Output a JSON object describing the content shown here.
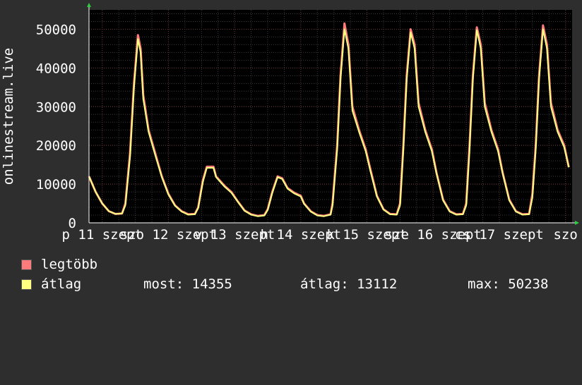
{
  "chart_data": {
    "type": "line",
    "ylabel": "onlinestream.live",
    "ylim": [
      0,
      55000
    ],
    "yticks": [
      0,
      10000,
      20000,
      30000,
      40000,
      50000
    ],
    "ytick_labels": [
      "0",
      "10000",
      "20000",
      "30000",
      "40000",
      "50000"
    ],
    "xtick_labels": [
      "p 11 szept",
      "szo 12 szept",
      "v 13 szept",
      "h 14 szept",
      "k 15 szept",
      "sze 16 szept",
      "cs 17 szept",
      "szo"
    ],
    "xticks_day": [
      0,
      1,
      2,
      3,
      4,
      5,
      6,
      7
    ],
    "xlim_day": [
      -0.2,
      7.1
    ],
    "grid": true,
    "series": [
      {
        "name": "legtöbb",
        "color": "#ff7b7b",
        "points": [
          [
            -0.2,
            12000
          ],
          [
            -0.1,
            8000
          ],
          [
            0.0,
            5000
          ],
          [
            0.1,
            3000
          ],
          [
            0.2,
            2300
          ],
          [
            0.3,
            2400
          ],
          [
            0.35,
            5000
          ],
          [
            0.42,
            18000
          ],
          [
            0.48,
            36000
          ],
          [
            0.54,
            48500
          ],
          [
            0.58,
            45000
          ],
          [
            0.62,
            33000
          ],
          [
            0.7,
            24000
          ],
          [
            0.8,
            18000
          ],
          [
            0.9,
            12000
          ],
          [
            1.0,
            7500
          ],
          [
            1.1,
            4500
          ],
          [
            1.2,
            3000
          ],
          [
            1.3,
            2200
          ],
          [
            1.4,
            2300
          ],
          [
            1.45,
            4000
          ],
          [
            1.52,
            11000
          ],
          [
            1.58,
            14500
          ],
          [
            1.68,
            14500
          ],
          [
            1.72,
            12000
          ],
          [
            1.85,
            9500
          ],
          [
            1.95,
            8000
          ],
          [
            2.05,
            5500
          ],
          [
            2.15,
            3200
          ],
          [
            2.25,
            2200
          ],
          [
            2.35,
            1800
          ],
          [
            2.45,
            2000
          ],
          [
            2.5,
            3500
          ],
          [
            2.57,
            8000
          ],
          [
            2.65,
            12000
          ],
          [
            2.72,
            11500
          ],
          [
            2.8,
            9000
          ],
          [
            2.9,
            7800
          ],
          [
            3.0,
            7000
          ],
          [
            3.05,
            5000
          ],
          [
            3.15,
            3000
          ],
          [
            3.25,
            2000
          ],
          [
            3.35,
            1800
          ],
          [
            3.45,
            2200
          ],
          [
            3.48,
            5000
          ],
          [
            3.55,
            20000
          ],
          [
            3.6,
            38000
          ],
          [
            3.66,
            51500
          ],
          [
            3.72,
            46000
          ],
          [
            3.78,
            30000
          ],
          [
            3.88,
            24000
          ],
          [
            3.98,
            19000
          ],
          [
            4.05,
            14000
          ],
          [
            4.15,
            7000
          ],
          [
            4.25,
            3500
          ],
          [
            4.35,
            2300
          ],
          [
            4.45,
            2200
          ],
          [
            4.5,
            5000
          ],
          [
            4.55,
            20000
          ],
          [
            4.6,
            38000
          ],
          [
            4.66,
            50000
          ],
          [
            4.72,
            46000
          ],
          [
            4.78,
            31000
          ],
          [
            4.88,
            24000
          ],
          [
            4.98,
            19000
          ],
          [
            5.05,
            13000
          ],
          [
            5.15,
            6000
          ],
          [
            5.25,
            3000
          ],
          [
            5.35,
            2200
          ],
          [
            5.45,
            2300
          ],
          [
            5.5,
            5000
          ],
          [
            5.55,
            20000
          ],
          [
            5.6,
            38000
          ],
          [
            5.66,
            50500
          ],
          [
            5.72,
            46000
          ],
          [
            5.78,
            31000
          ],
          [
            5.88,
            24000
          ],
          [
            5.98,
            19000
          ],
          [
            6.05,
            13000
          ],
          [
            6.15,
            6000
          ],
          [
            6.25,
            3000
          ],
          [
            6.35,
            2200
          ],
          [
            6.45,
            2300
          ],
          [
            6.5,
            7500
          ],
          [
            6.55,
            20000
          ],
          [
            6.6,
            38000
          ],
          [
            6.66,
            51000
          ],
          [
            6.72,
            46000
          ],
          [
            6.78,
            31000
          ],
          [
            6.88,
            24000
          ],
          [
            6.98,
            20000
          ],
          [
            7.05,
            14355
          ]
        ]
      },
      {
        "name": "átlag",
        "color": "#ffff80",
        "points": [
          [
            -0.2,
            12000
          ],
          [
            -0.1,
            8000
          ],
          [
            0.0,
            5000
          ],
          [
            0.1,
            3000
          ],
          [
            0.2,
            2300
          ],
          [
            0.3,
            2400
          ],
          [
            0.35,
            4500
          ],
          [
            0.42,
            17000
          ],
          [
            0.48,
            35000
          ],
          [
            0.54,
            47500
          ],
          [
            0.58,
            44000
          ],
          [
            0.62,
            32000
          ],
          [
            0.7,
            23500
          ],
          [
            0.8,
            17500
          ],
          [
            0.9,
            11800
          ],
          [
            1.0,
            7300
          ],
          [
            1.1,
            4400
          ],
          [
            1.2,
            2900
          ],
          [
            1.3,
            2100
          ],
          [
            1.4,
            2200
          ],
          [
            1.45,
            3800
          ],
          [
            1.52,
            10500
          ],
          [
            1.58,
            14200
          ],
          [
            1.68,
            14200
          ],
          [
            1.72,
            11800
          ],
          [
            1.85,
            9300
          ],
          [
            1.95,
            7800
          ],
          [
            2.05,
            5400
          ],
          [
            2.15,
            3100
          ],
          [
            2.25,
            2100
          ],
          [
            2.35,
            1700
          ],
          [
            2.45,
            1900
          ],
          [
            2.5,
            3300
          ],
          [
            2.57,
            7700
          ],
          [
            2.65,
            11800
          ],
          [
            2.72,
            11300
          ],
          [
            2.8,
            8800
          ],
          [
            2.9,
            7600
          ],
          [
            3.0,
            6800
          ],
          [
            3.05,
            4900
          ],
          [
            3.15,
            2900
          ],
          [
            3.25,
            1900
          ],
          [
            3.35,
            1700
          ],
          [
            3.45,
            2100
          ],
          [
            3.48,
            4500
          ],
          [
            3.55,
            19000
          ],
          [
            3.6,
            37000
          ],
          [
            3.66,
            50000
          ],
          [
            3.72,
            45000
          ],
          [
            3.78,
            29000
          ],
          [
            3.88,
            23500
          ],
          [
            3.98,
            18500
          ],
          [
            4.05,
            13500
          ],
          [
            4.15,
            6800
          ],
          [
            4.25,
            3400
          ],
          [
            4.35,
            2200
          ],
          [
            4.45,
            2100
          ],
          [
            4.5,
            4500
          ],
          [
            4.55,
            19000
          ],
          [
            4.6,
            37000
          ],
          [
            4.66,
            49200
          ],
          [
            4.72,
            45000
          ],
          [
            4.78,
            30000
          ],
          [
            4.88,
            23500
          ],
          [
            4.98,
            18500
          ],
          [
            5.05,
            12800
          ],
          [
            5.15,
            5800
          ],
          [
            5.25,
            2900
          ],
          [
            5.35,
            2100
          ],
          [
            5.45,
            2200
          ],
          [
            5.5,
            4500
          ],
          [
            5.55,
            19000
          ],
          [
            5.6,
            37000
          ],
          [
            5.66,
            49800
          ],
          [
            5.72,
            45000
          ],
          [
            5.78,
            30000
          ],
          [
            5.88,
            23500
          ],
          [
            5.98,
            18500
          ],
          [
            6.05,
            12800
          ],
          [
            6.15,
            5800
          ],
          [
            6.25,
            2900
          ],
          [
            6.35,
            2100
          ],
          [
            6.45,
            2200
          ],
          [
            6.5,
            6500
          ],
          [
            6.55,
            19000
          ],
          [
            6.6,
            37000
          ],
          [
            6.66,
            50000
          ],
          [
            6.72,
            45000
          ],
          [
            6.78,
            30000
          ],
          [
            6.88,
            23500
          ],
          [
            6.98,
            19500
          ],
          [
            7.05,
            14355
          ]
        ]
      }
    ]
  },
  "legend": {
    "items": [
      {
        "label": "legtöbb",
        "color": "#ff7b7b"
      },
      {
        "label": "átlag",
        "color": "#ffff80"
      }
    ],
    "stats": {
      "most": "most: 14355",
      "atlag": "átlag: 13112",
      "max": "max: 50238"
    }
  }
}
